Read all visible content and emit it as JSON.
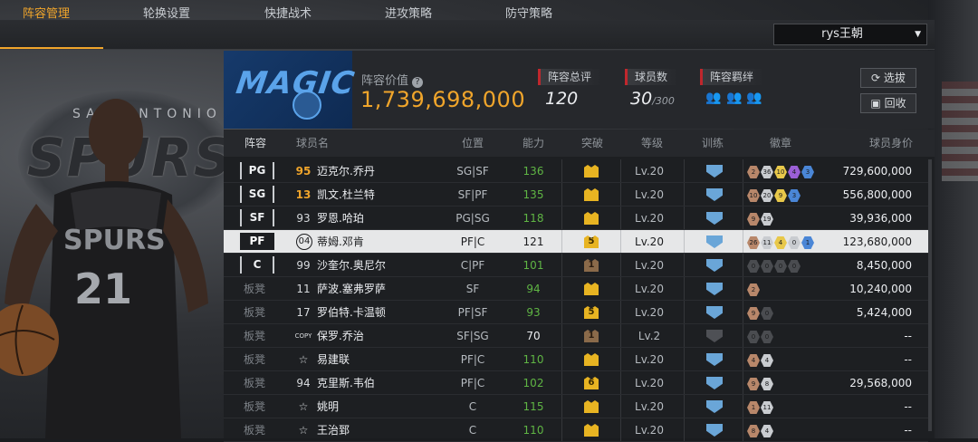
{
  "nav": {
    "tabs": [
      "阵容管理",
      "轮换设置",
      "快捷战术",
      "进攻策略",
      "防守策略"
    ],
    "team_name": "rys王朝"
  },
  "header": {
    "value_label": "阵容价值",
    "value": "1,739,698,000",
    "rating_label": "阵容总评",
    "rating": "120",
    "players_label": "球员数",
    "players": "30",
    "players_max": "/300",
    "chem_label": "阵容羁绊",
    "select_button": "选拔",
    "recycle_button": "回收"
  },
  "table": {
    "headers": [
      "阵容",
      "球员名",
      "位置",
      "能力",
      "突破",
      "等级",
      "训练",
      "徽章",
      "球员身价"
    ],
    "rows": [
      {
        "slot": "PG",
        "num": "95",
        "gold": true,
        "name": "迈克尔.乔丹",
        "pos": "SG|SF",
        "rating": "136",
        "green": true,
        "breakthrough": "",
        "crown": "gold",
        "level": "Lv.20",
        "train": true,
        "badges": [
          [
            "br",
            "2"
          ],
          [
            "si",
            "36"
          ],
          [
            "go",
            "10"
          ],
          [
            "pu",
            "4"
          ],
          [
            "bl",
            "3"
          ]
        ],
        "worth": "729,600,000"
      },
      {
        "slot": "SG",
        "num": "13",
        "gold": true,
        "name": "凯文.杜兰特",
        "pos": "SF|PF",
        "rating": "135",
        "green": true,
        "breakthrough": "",
        "crown": "gold",
        "level": "Lv.20",
        "train": true,
        "badges": [
          [
            "br",
            "10"
          ],
          [
            "si",
            "20"
          ],
          [
            "go",
            "9"
          ],
          [
            "bl",
            "3"
          ]
        ],
        "worth": "556,800,000"
      },
      {
        "slot": "SF",
        "num": "93",
        "gold": false,
        "name": "罗恩.哈珀",
        "pos": "PG|SG",
        "rating": "118",
        "green": true,
        "breakthrough": "",
        "crown": "gold",
        "level": "Lv.20",
        "train": true,
        "badges": [
          [
            "br",
            "9"
          ],
          [
            "si",
            "19"
          ]
        ],
        "worth": "39,936,000"
      },
      {
        "slot": "PF",
        "num": "04",
        "gold": false,
        "name": "蒂姆.邓肯",
        "pos": "PF|C",
        "rating": "121",
        "green": false,
        "breakthrough": "5",
        "crown": "gold",
        "level": "Lv.20",
        "train": true,
        "badges": [
          [
            "br",
            "26"
          ],
          [
            "si",
            "11"
          ],
          [
            "go",
            "4"
          ],
          [
            "si",
            "0"
          ],
          [
            "bl",
            "1"
          ]
        ],
        "worth": "123,680,000"
      },
      {
        "slot": "C",
        "num": "99",
        "gold": false,
        "name": "沙奎尔.奥尼尔",
        "pos": "C|PF",
        "rating": "101",
        "green": true,
        "breakthrough": "1",
        "crown": "dark",
        "level": "Lv.20",
        "train": true,
        "badges": [
          [
            "dk",
            "0"
          ],
          [
            "dk",
            "0"
          ],
          [
            "dk",
            "0"
          ],
          [
            "dk",
            "0"
          ]
        ],
        "worth": "8,450,000"
      },
      {
        "slot": "板凳",
        "num": "11",
        "gold": false,
        "name": "萨波.塞弗罗萨",
        "pos": "SF",
        "rating": "94",
        "green": true,
        "breakthrough": "",
        "crown": "gold",
        "level": "Lv.20",
        "train": true,
        "badges": [
          [
            "br",
            "2"
          ]
        ],
        "worth": "10,240,000"
      },
      {
        "slot": "板凳",
        "num": "17",
        "gold": false,
        "name": "罗伯特.卡温顿",
        "pos": "PF|SF",
        "rating": "93",
        "green": true,
        "breakthrough": "5",
        "crown": "gold",
        "level": "Lv.20",
        "train": true,
        "badges": [
          [
            "br",
            "9"
          ],
          [
            "dk",
            "0"
          ]
        ],
        "worth": "5,424,000"
      },
      {
        "slot": "板凳",
        "num": "COPY",
        "gold": false,
        "name": "保罗.乔治",
        "pos": "SF|SG",
        "rating": "70",
        "green": false,
        "breakthrough": "1",
        "crown": "dark",
        "level": "Lv.2",
        "train": false,
        "badges": [
          [
            "dk",
            "0"
          ],
          [
            "dk",
            "0"
          ]
        ],
        "worth": "--"
      },
      {
        "slot": "板凳",
        "num": "☆",
        "gold": false,
        "name": "易建联",
        "pos": "PF|C",
        "rating": "110",
        "green": true,
        "breakthrough": "",
        "crown": "gold",
        "level": "Lv.20",
        "train": true,
        "badges": [
          [
            "br",
            "4"
          ],
          [
            "si",
            "4"
          ]
        ],
        "worth": "--"
      },
      {
        "slot": "板凳",
        "num": "94",
        "gold": false,
        "name": "克里斯.韦伯",
        "pos": "PF|C",
        "rating": "102",
        "green": true,
        "breakthrough": "6",
        "crown": "gold",
        "level": "Lv.20",
        "train": true,
        "badges": [
          [
            "br",
            "9"
          ],
          [
            "si",
            "8"
          ]
        ],
        "worth": "29,568,000"
      },
      {
        "slot": "板凳",
        "num": "☆",
        "gold": false,
        "name": "姚明",
        "pos": "C",
        "rating": "115",
        "green": true,
        "breakthrough": "",
        "crown": "gold",
        "level": "Lv.20",
        "train": true,
        "badges": [
          [
            "br",
            "1"
          ],
          [
            "si",
            "11"
          ]
        ],
        "worth": "--"
      },
      {
        "slot": "板凳",
        "num": "☆",
        "gold": false,
        "name": "王治郅",
        "pos": "C",
        "rating": "110",
        "green": true,
        "breakthrough": "",
        "crown": "gold",
        "level": "Lv.20",
        "train": true,
        "badges": [
          [
            "br",
            "8"
          ],
          [
            "si",
            "4"
          ]
        ],
        "worth": "--"
      }
    ]
  },
  "background": {
    "team_logo_text": "SPURS",
    "team_logo_sub": "SAN ANTONIO",
    "player_jersey": "21",
    "panel_logo": "MAGIC"
  },
  "colors": {
    "accent": "#f0a52b",
    "green": "#5fb544",
    "red": "#c0272d"
  }
}
